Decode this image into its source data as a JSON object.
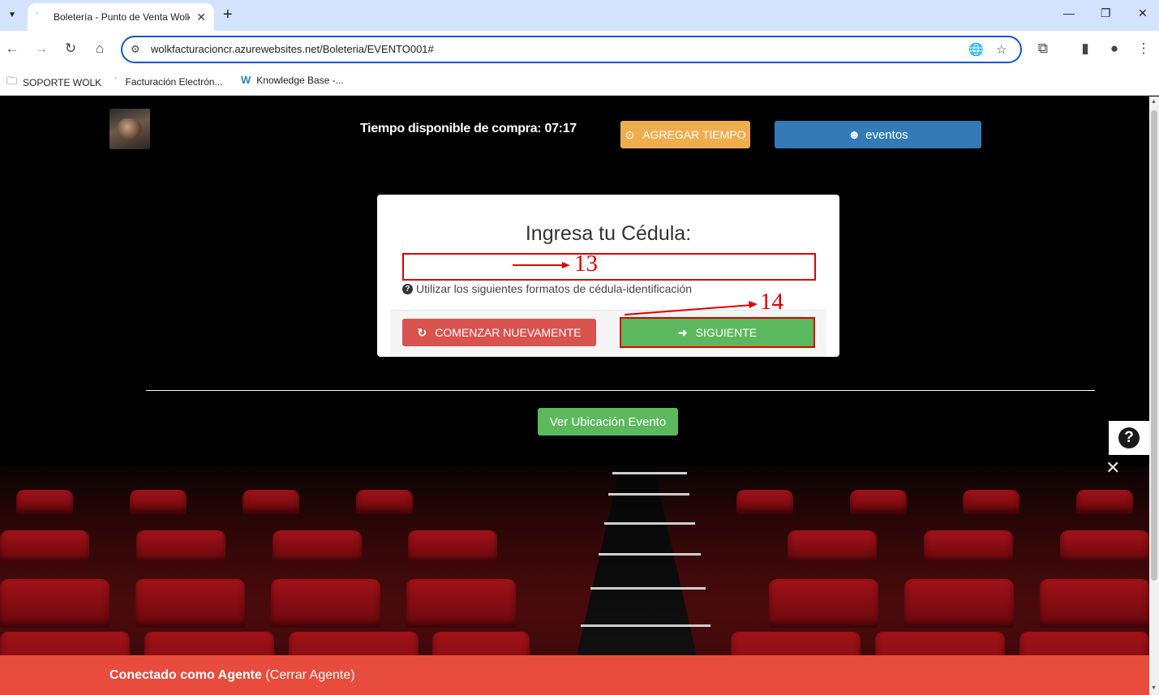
{
  "browser": {
    "tab_title": "Boletería - Punto de Venta Wolk",
    "url": "wolkfacturacioncr.azurewebsites.net/Boleteria/EVENTO001#",
    "bookmarks": [
      {
        "label": "SOPORTE WOLK",
        "icon": "folder-icon"
      },
      {
        "label": "Facturación Electrón...",
        "icon": "wolk-favicon"
      },
      {
        "label": "Knowledge Base -...",
        "icon": "wolk-w-logo"
      }
    ]
  },
  "header": {
    "timer_label": "Tiempo disponible de compra: 07:17",
    "add_time_label": "AGREGAR TIEMPO",
    "events_label": "eventos"
  },
  "form": {
    "title": "Ingresa tu Cédula:",
    "id_value": "",
    "help_text": "Utilizar los siguientes formatos de cédula-identificación",
    "reset_label": "COMENZAR NUEVAMENTE",
    "next_label": "SIGUIENTE"
  },
  "annotations": {
    "marker_13": "13",
    "marker_14": "14",
    "color": "#e00000"
  },
  "location_button_label": "Ver Ubicación Evento",
  "agent": {
    "connected_label": "Conectado como Agente",
    "logout_label": "(Cerrar Agente)"
  },
  "colors": {
    "warning": "#f0ad4e",
    "primary": "#337ab7",
    "danger": "#d9534f",
    "success": "#5cb85c",
    "agent_bar": "#e74c3c"
  }
}
